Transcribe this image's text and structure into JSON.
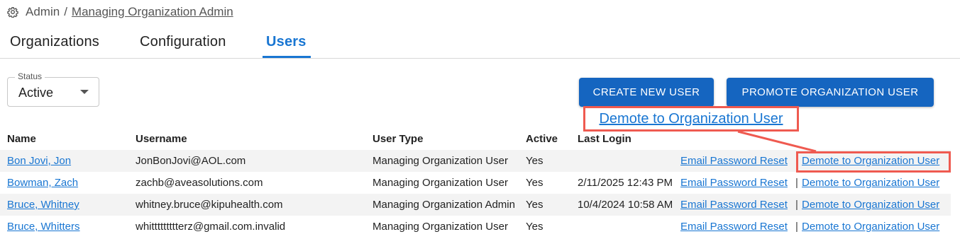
{
  "breadcrumb": {
    "root": "Admin",
    "separator": "/",
    "current": "Managing Organization Admin",
    "icon": "gear-icon"
  },
  "tabs": [
    {
      "label": "Organizations",
      "active": false
    },
    {
      "label": "Configuration",
      "active": false
    },
    {
      "label": "Users",
      "active": true
    }
  ],
  "status_filter": {
    "label": "Status",
    "value": "Active"
  },
  "buttons": {
    "create": "CREATE NEW USER",
    "promote": "PROMOTE ORGANIZATION USER"
  },
  "callout": {
    "text": "Demote to Organization User"
  },
  "table": {
    "headers": {
      "name": "Name",
      "username": "Username",
      "user_type": "User Type",
      "active": "Active",
      "last_login": "Last Login"
    },
    "rows": [
      {
        "name": "Bon Jovi, Jon",
        "username": "JonBonJovi@AOL.com",
        "user_type": "Managing Organization User",
        "active": "Yes",
        "last_login": "",
        "reset": "Email Password Reset",
        "sep": "|",
        "demote": "Demote to Organization User"
      },
      {
        "name": "Bowman, Zach",
        "username": "zachb@aveasolutions.com",
        "user_type": "Managing Organization User",
        "active": "Yes",
        "last_login": "2/11/2025 12:43 PM",
        "reset": "Email Password Reset",
        "sep": "|",
        "demote": "Demote to Organization User"
      },
      {
        "name": "Bruce, Whitney",
        "username": "whitney.bruce@kipuhealth.com",
        "user_type": "Managing Organization Admin",
        "active": "Yes",
        "last_login": "10/4/2024 10:58 AM",
        "reset": "Email Password Reset",
        "sep": "|",
        "demote": "Demote to Organization User"
      },
      {
        "name": "Bruce, Whitters",
        "username": "whittttttttterz@gmail.com.invalid",
        "user_type": "Managing Organization User",
        "active": "Yes",
        "last_login": "",
        "reset": "Email Password Reset",
        "sep": "|",
        "demote": "Demote to Organization User"
      }
    ]
  },
  "colors": {
    "accent": "#1976d2",
    "button": "#1565c0",
    "annotation": "#ef5a50"
  }
}
